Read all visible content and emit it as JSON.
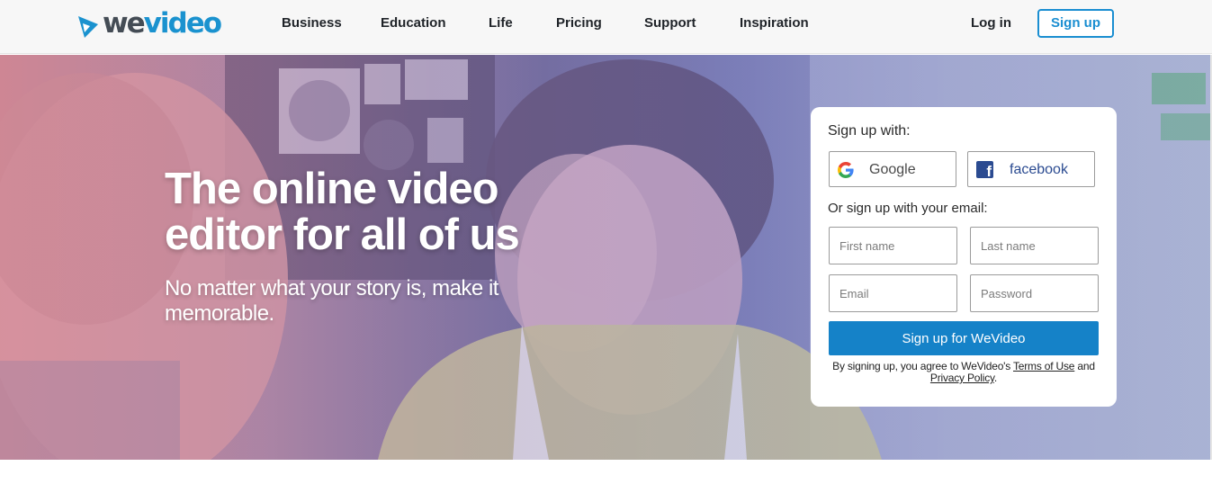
{
  "brand": {
    "logo_we": "we",
    "logo_video": "video"
  },
  "nav": {
    "items": [
      {
        "label": "Business"
      },
      {
        "label": "Education"
      },
      {
        "label": "Life"
      },
      {
        "label": "Pricing"
      },
      {
        "label": "Support"
      },
      {
        "label": "Inspiration"
      }
    ],
    "login_label": "Log in",
    "signup_label": "Sign up"
  },
  "hero": {
    "title": "The online video editor for all of us",
    "subtitle": "No matter what your story is, make it memorable."
  },
  "signup": {
    "heading": "Sign up with:",
    "google_label": "Google",
    "facebook_label": "facebook",
    "email_heading": "Or sign up with your email:",
    "first_name_placeholder": "First name",
    "last_name_placeholder": "Last name",
    "email_placeholder": "Email",
    "password_placeholder": "Password",
    "submit_label": "Sign up for WeVideo",
    "terms_prefix": "By signing up, you agree to WeVideo's",
    "terms_link": "Terms of Use",
    "terms_and": "and",
    "privacy_link": "Privacy Policy",
    "terms_suffix": "."
  },
  "colors": {
    "accent_blue": "#1a8ed1",
    "submit_blue": "#1582c8",
    "facebook_blue": "#2b4b91",
    "logo_dark": "#444c55"
  },
  "icons": [
    "wevideo-logo-icon",
    "google-icon",
    "facebook-icon"
  ]
}
